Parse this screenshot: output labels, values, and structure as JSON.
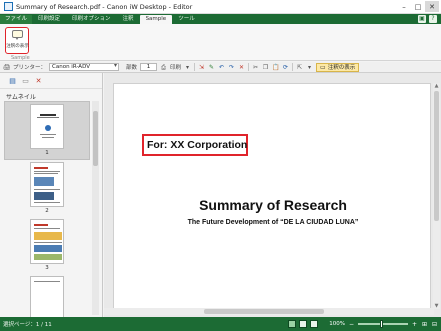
{
  "window": {
    "title": "Summary of Research.pdf - Canon iW Desktop - Editor",
    "minimize_glyph": "–",
    "maximize_glyph": "□",
    "close_glyph": "✕"
  },
  "tabs": [
    {
      "label": "ファイル"
    },
    {
      "label": "印刷設定"
    },
    {
      "label": "印刷オプション"
    },
    {
      "label": "注釈"
    },
    {
      "label": "Sample"
    },
    {
      "label": "ツール"
    }
  ],
  "tab_help": {
    "minimize_ribbon": "▣",
    "help": "?"
  },
  "ribbon": {
    "show_annotations_label": "注釈の表示",
    "group_label": "Sample"
  },
  "toolbar": {
    "printer_label": "プリンター：",
    "printer_value": "Canon iR-ADV",
    "copies_label": "部数",
    "copies_value": "1",
    "print_label": "印刷",
    "show_annotations_label": "注釈の表示"
  },
  "sidebar": {
    "title": "サムネイル",
    "thumbnails": [
      {
        "number": "1",
        "selected": true
      },
      {
        "number": "2",
        "selected": false
      },
      {
        "number": "3",
        "selected": false
      },
      {
        "number": "",
        "selected": false
      }
    ]
  },
  "document": {
    "annotation_text": "For: XX Corporation",
    "title": "Summary of Research",
    "subtitle": "The Future Development of “DE LA CIUDAD LUNA”"
  },
  "status": {
    "pages": "選択ページ：1 / 11",
    "zoom": "100%",
    "zoom_out": "−",
    "zoom_in": "+"
  },
  "colors": {
    "ribbon_green": "#1c6b34",
    "highlight_red": "#e0242b"
  }
}
